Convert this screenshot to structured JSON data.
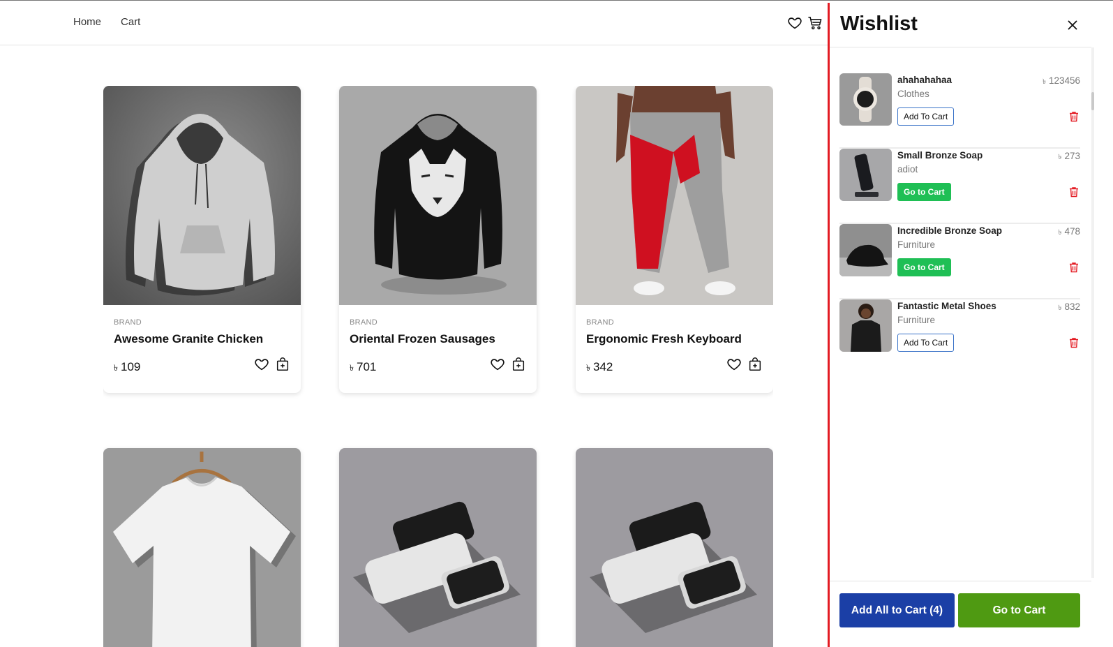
{
  "nav": {
    "home": "Home",
    "cart": "Cart"
  },
  "products": [
    {
      "brand": "BRAND",
      "name": "Awesome Granite Chicken",
      "currency": "৳",
      "price": "109",
      "image": "grey-hoodie"
    },
    {
      "brand": "BRAND",
      "name": "Oriental Frozen Sausages",
      "currency": "৳",
      "price": "701",
      "image": "black-wolf-hoodie"
    },
    {
      "brand": "BRAND",
      "name": "Ergonomic Fresh Keyboard",
      "currency": "৳",
      "price": "342",
      "image": "grey-red-joggers"
    },
    {
      "image": "white-tshirt-on-hanger"
    },
    {
      "image": "phone-cases"
    },
    {
      "image": "phone-cases"
    }
  ],
  "wishlist": {
    "title": "Wishlist",
    "items": [
      {
        "name": "ahahahahaa",
        "category": "Clothes",
        "currency": "৳",
        "price": "123456",
        "button": "Add To Cart",
        "button_style": "outline",
        "image": "smartwatch"
      },
      {
        "name": "Small Bronze Soap",
        "category": "adiot",
        "currency": "৳",
        "price": "273",
        "button": "Go to Cart",
        "button_style": "green",
        "image": "phone-stand"
      },
      {
        "name": "Incredible Bronze Soap",
        "category": "Furniture",
        "currency": "৳",
        "price": "478",
        "button": "Go to Cart",
        "button_style": "green",
        "image": "black-cap"
      },
      {
        "name": "Fantastic Metal Shoes",
        "category": "Furniture",
        "currency": "৳",
        "price": "832",
        "button": "Add To Cart",
        "button_style": "outline",
        "image": "woman-in-tshirt"
      }
    ],
    "add_all_label": "Add All to Cart (4)",
    "go_to_cart_label": "Go to Cart"
  },
  "colors": {
    "accent_red": "#e31b23",
    "blue": "#1b3fa6",
    "green_button": "#1fbf55",
    "dark_green": "#4f9a12"
  }
}
